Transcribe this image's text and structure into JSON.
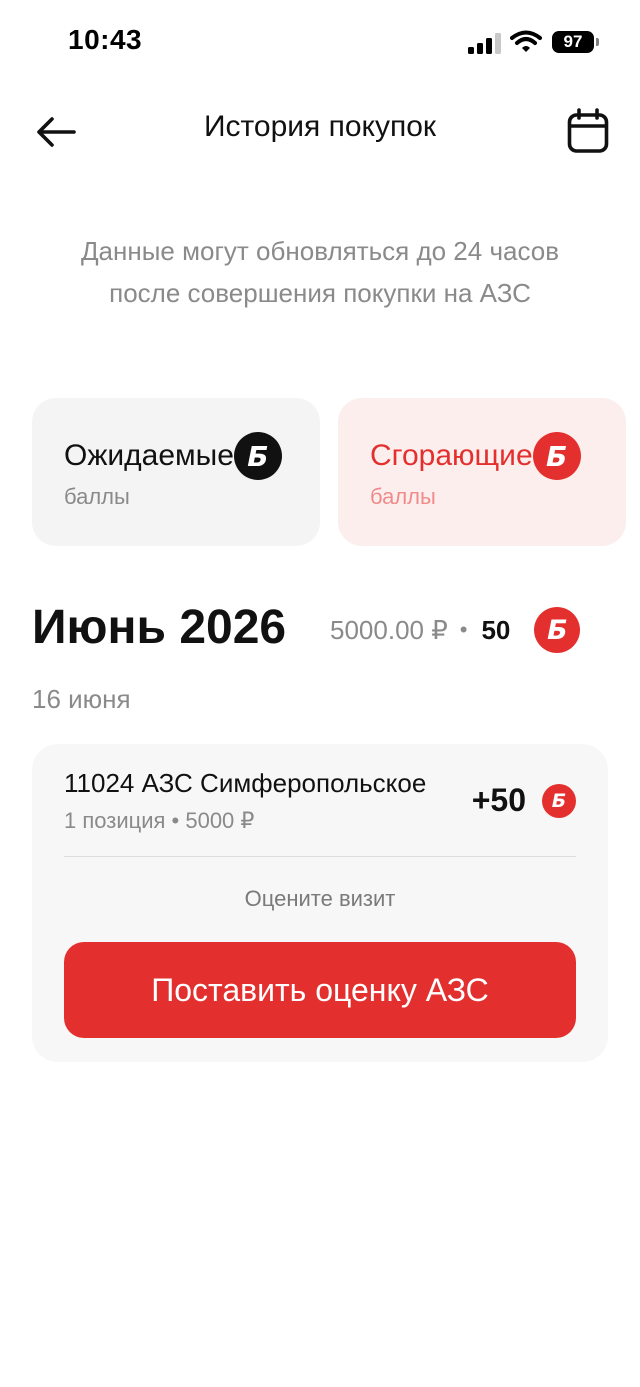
{
  "status_bar": {
    "time": "10:43",
    "battery": "97"
  },
  "header": {
    "title": "История покупок"
  },
  "notice": "Данные могут обновляться до 24 часов после совершения покупки на АЗС",
  "points_cards": {
    "expected": {
      "title": "Ожидаемые",
      "subtitle": "баллы",
      "badge": "Б"
    },
    "burning": {
      "title": "Сгорающие",
      "subtitle": "баллы",
      "badge": "Б"
    }
  },
  "month": {
    "title": "Июнь 2026",
    "amount": "5000.00 ₽",
    "separator": "•",
    "points": "50",
    "badge": "Б"
  },
  "date_label": "16 июня",
  "purchase": {
    "station": "11024 АЗС Симферопольское",
    "details": "1 позиция • 5000 ₽",
    "earned": "+50",
    "badge": "Б",
    "rate_prompt": "Оцените визит",
    "rate_button": "Поставить оценку АЗС"
  },
  "colors": {
    "accent": "#e3302f",
    "burning_bg": "#fdeeee",
    "card_bg": "#f4f4f4",
    "muted_text": "#8a8a8a"
  },
  "icons": [
    "signal-icon",
    "wifi-icon",
    "battery-icon",
    "back-arrow-icon",
    "calendar-icon",
    "bonus-b-icon"
  ]
}
